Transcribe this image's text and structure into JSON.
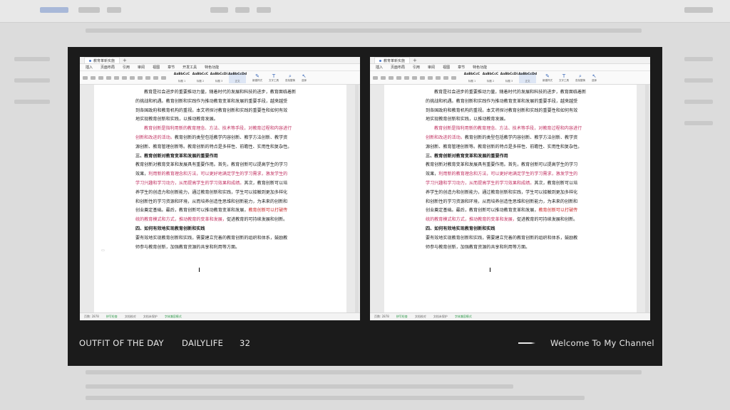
{
  "caption": {
    "left1": "OUTFIT OF THE DAY",
    "left2": "DAILYLIFE",
    "left3": "32",
    "right": "Welcome To My Channel"
  },
  "doc": {
    "tab_left": "教育革新实施",
    "tab_right": "教育革新实施",
    "menu": [
      "插入",
      "页面布局",
      "引用",
      "审阅",
      "视图",
      "章节",
      "开发工具",
      "特色功能"
    ],
    "menu_right": [
      "插入",
      "页面布局",
      "引用",
      "审阅",
      "视图",
      "章节",
      "特色功能"
    ],
    "styles": [
      {
        "a": "AaBbCcC",
        "b": "标题 1"
      },
      {
        "a": "AaBbCcC",
        "b": "标题 2"
      },
      {
        "a": "AaBbCcDi",
        "b": "标题 3"
      },
      {
        "a": "AaBbCcDd",
        "b": "正文"
      }
    ],
    "tools": [
      "新建样式",
      "文字工具",
      "查找替换",
      "选择"
    ],
    "paragraphs": {
      "p1a": "教育是社会进步的重要推动力量，随着时代的发展和科技的进步，教育面临着新",
      "p1b": "的挑战和机遇。教育创新和实践作为推动教育变革和发展的重要手段，越来越受",
      "p1c": "到各国政府和教育机构的重视。本文将探讨教育创新和实践的重要性和如何有效",
      "p1d": "地实现教育创新和实践，以推动教育发展。",
      "p2a_red": "教育创新是指利用新的教育理念、方法、技术等手段，对教育过程和内容进行",
      "p2b_red": "创新和改进的活动。",
      "p2b": "教育创新的类型包括教学内容创新、教学方法创新、教学资",
      "p2c": "源创新、教育管理创新等。教育创新的特点是多样性、前瞻性、实用性和复杂性。",
      "h3": "三、教育创新对教育变革和发展的重要作用",
      "p3a": "教育创新对教育变革和发展具有重要作用。首先，教育创新可以提高学生的学习",
      "p3b1": "效果，",
      "p3b_red": "利用新的教育理念和方法，可以更好地满足学生的学习需求，激发学生的",
      "p3c_red": "学习兴趣和学习动力，从而提高学生的学习效果和成绩。",
      "p3c": "其次，教育创新可以培",
      "p3d": "养学生的创造力和创新能力，通过教育创新和实践，学生可以接触到更加多样化",
      "p3e": "和创新性的学习资源和环境，从而培养创造性思维和创新能力，为未来的创新和",
      "p3f": "创业奠定基础。最后，教育创新可以推动教育变革和发展，",
      "p3f_red": "教育创新可以打破传",
      "p3g_red": "统的教育模式和方式，推动教育的变革和发展，",
      "p3g": "促进教育的可持续发展和创新。",
      "h4": "四、如何有效地实现教育创新和实践",
      "p4a": "要有效地实现教育创新和实践，需要建立完善的教育创新的组织和体系，鼓励教",
      "p4b": "师参与教育创新，加强教育资源的共享和利用等方面。"
    },
    "status": {
      "page": "页数: 2878",
      "spell": "拼写检查",
      "doc_check": "文档校对",
      "protect": "文档未保护",
      "compat": "字体兼容模式"
    }
  }
}
